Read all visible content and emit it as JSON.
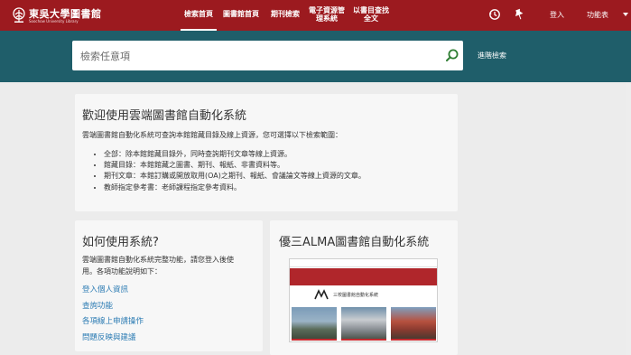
{
  "header": {
    "logo_text": "東吳大學圖書館",
    "logo_sub": "Soochow University Library",
    "nav": [
      {
        "lines": [
          "檢索首頁"
        ],
        "active": true
      },
      {
        "lines": [
          "圖書館首頁"
        ],
        "active": false
      },
      {
        "lines": [
          "期刊檢索"
        ],
        "active": false
      },
      {
        "lines": [
          "電子資源管",
          "理系統"
        ],
        "active": false
      },
      {
        "lines": [
          "以書目查找",
          "全文"
        ],
        "active": false
      }
    ],
    "login_label": "登入",
    "menu_label": "功能表",
    "icons": [
      "history-icon",
      "pin-icon"
    ]
  },
  "search": {
    "placeholder": "檢索任意項",
    "advanced_label": "進階檢索"
  },
  "welcome": {
    "title": "歡迎使用雲端圖書館自動化系統",
    "intro": "雲端圖書館自動化系統可查詢本館館藏目錄及線上資源，您可選擇以下檢索範圍：",
    "bullets": [
      "全部：除本館館藏目錄外，同時查詢期刊文章等線上資源。",
      "館藏目錄：本館館藏之圖書、期刊、報紙、非書資料等。",
      "期刊文章：本館訂購或開放取用(OA)之期刊、報紙、會議論文等線上資源的文章。",
      "教師指定參考書：老師課程指定參考資料。"
    ]
  },
  "howto": {
    "title": "如何使用系統?",
    "intro_line1": "雲端圖書館自動化系統完整功能，請您登入後使",
    "intro_line2": "用。各項功能說明如下：",
    "links": [
      "登入個人資訊",
      "查詢功能",
      "各項線上申請操作",
      "問題反映與建議"
    ]
  },
  "alma": {
    "title": "優三ALMA圖書館自動化系統",
    "thumb_logo": "優三 ALMA",
    "thumb_title": "三校圖書館自動化系統",
    "photo_captions": [
      "",
      "",
      ""
    ]
  },
  "colors": {
    "brand_red": "#9c1a1f",
    "search_band": "#1f5e6a",
    "link_blue": "#2b7bb3"
  }
}
